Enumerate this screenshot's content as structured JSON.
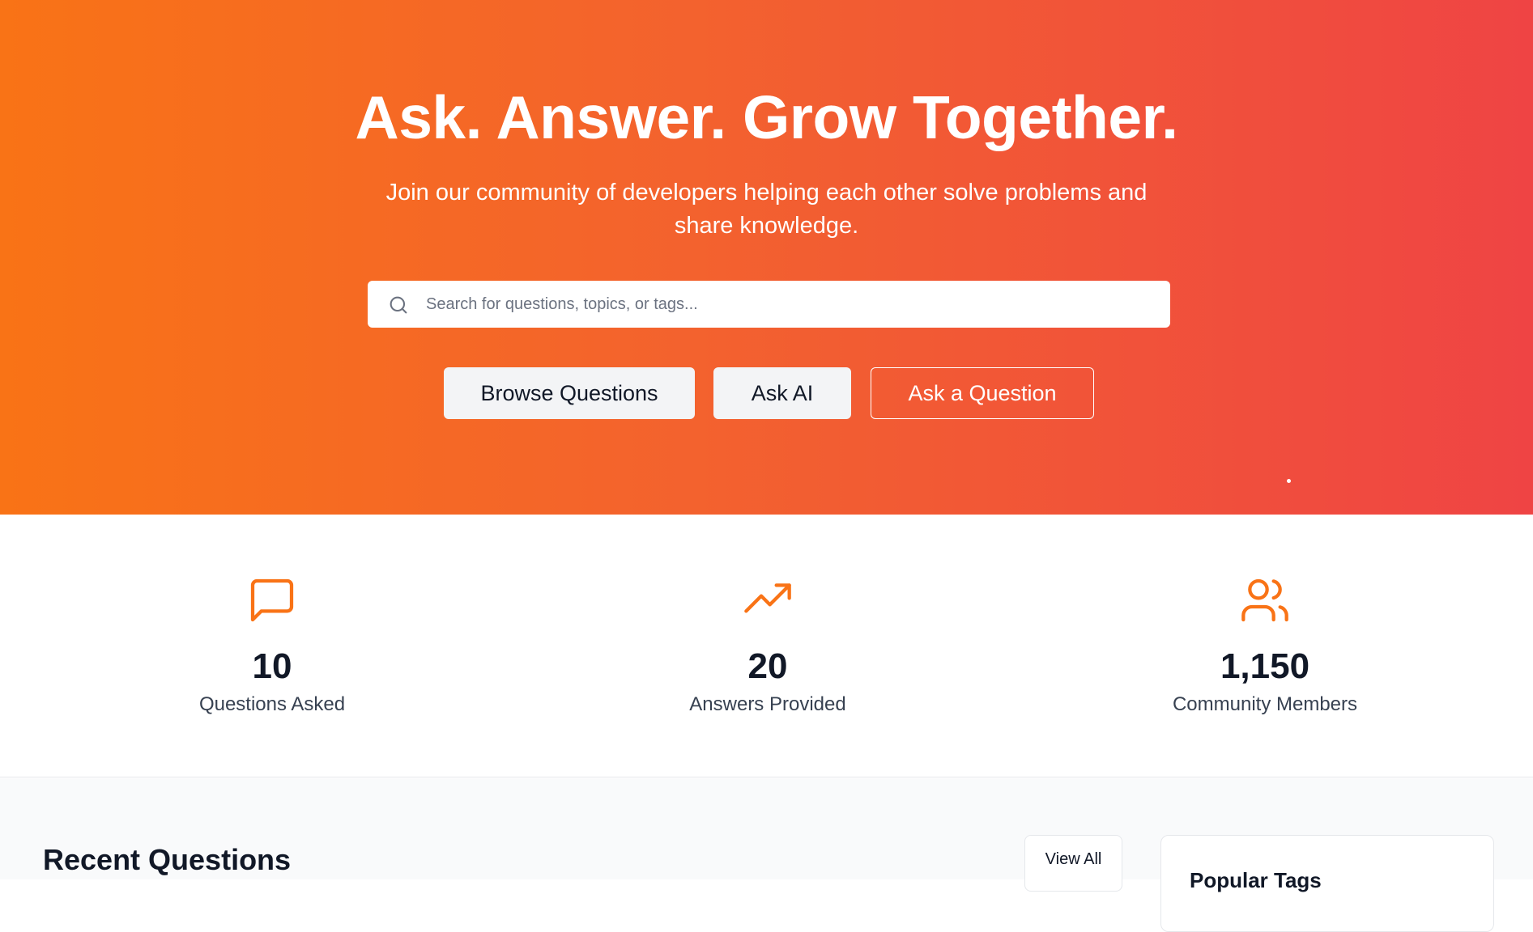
{
  "hero": {
    "title": "Ask. Answer. Grow Together.",
    "subtitle": "Join our community of developers helping each other solve problems and share knowledge.",
    "search": {
      "placeholder": "Search for questions, topics, or tags...",
      "value": "",
      "icon": "search-icon"
    },
    "buttons": {
      "browse": "Browse Questions",
      "ask_ai": "Ask AI",
      "ask_question": "Ask a Question"
    },
    "gradient": {
      "from": "#f97316",
      "to": "#ef4444"
    }
  },
  "stats": [
    {
      "icon": "message-square-icon",
      "value": "10",
      "label": "Questions Asked"
    },
    {
      "icon": "trending-up-icon",
      "value": "20",
      "label": "Answers Provided"
    },
    {
      "icon": "users-icon",
      "value": "1,150",
      "label": "Community Members"
    }
  ],
  "recent": {
    "title": "Recent Questions",
    "view_all": "View All"
  },
  "sidebar": {
    "popular_tags_title": "Popular Tags"
  },
  "colors": {
    "accent": "#f97316",
    "text_dark": "#111827",
    "text_muted": "#374151"
  }
}
